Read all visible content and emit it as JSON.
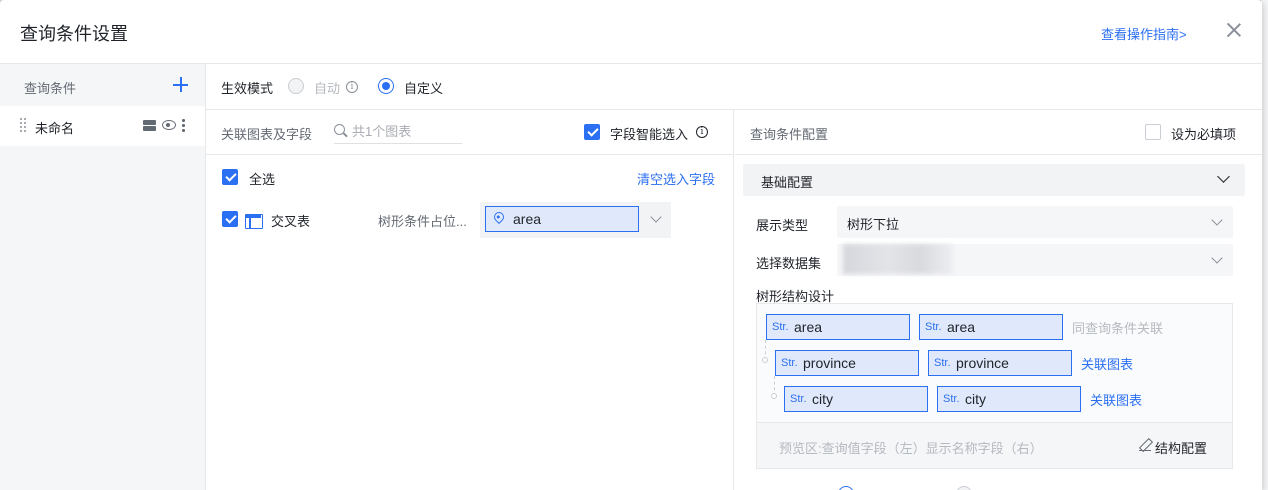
{
  "dialog": {
    "title": "查询条件设置",
    "guide_link": "查看操作指南>"
  },
  "sidebar": {
    "title": "查询条件",
    "items": [
      {
        "name": "未命名"
      }
    ]
  },
  "mode": {
    "label": "生效模式",
    "options": [
      {
        "label": "自动",
        "selected": false,
        "disabled": true
      },
      {
        "label": "自定义",
        "selected": true,
        "disabled": false
      }
    ]
  },
  "linked": {
    "label": "关联图表及字段",
    "search_placeholder": "共1个图表",
    "smart_select_label": "字段智能选入",
    "smart_select_checked": true,
    "select_all_label": "全选",
    "select_all_checked": true,
    "clear_link": "清空选入字段",
    "charts": [
      {
        "name": "交叉表",
        "checked": true,
        "field_label": "树形条件占位...",
        "field_value": "area"
      }
    ]
  },
  "config": {
    "title": "查询条件配置",
    "required_label": "设为必填项",
    "required_checked": false,
    "section_title": "基础配置",
    "display_type_label": "展示类型",
    "display_type_value": "树形下拉",
    "dataset_label": "选择数据集",
    "tree_design_label": "树形结构设计",
    "tree": [
      {
        "left": "area",
        "right": "area",
        "action": "同查询条件关联",
        "action_active": false
      },
      {
        "left": "province",
        "right": "province",
        "action": "关联图表",
        "action_active": true
      },
      {
        "left": "city",
        "right": "city",
        "action": "关联图表",
        "action_active": true
      }
    ],
    "str_tag": "Str.",
    "preview_hint": "预览区:查询值字段（左）显示名称字段（右）",
    "structure_config": "结构配置"
  },
  "colors": {
    "primary": "#2b6ff2",
    "text": "#1f2329",
    "muted": "#646a73",
    "tag_bg": "#e0e9fb"
  }
}
